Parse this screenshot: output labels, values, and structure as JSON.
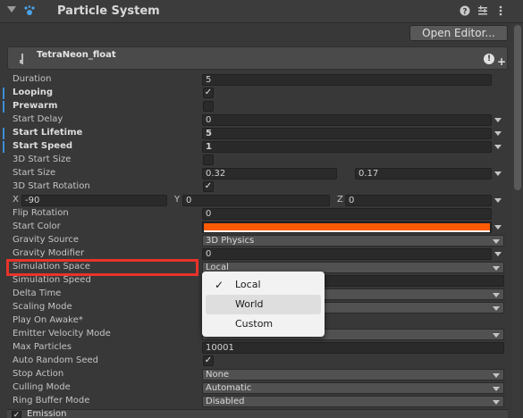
{
  "header": {
    "title": "Particle System",
    "icons": [
      "help-icon",
      "preset-icon",
      "more-icon"
    ]
  },
  "open_editor_label": "Open Editor...",
  "module": {
    "name": "TetraNeon_float",
    "plus": "+"
  },
  "rows": {
    "duration": {
      "label": "Duration",
      "value": "5"
    },
    "looping": {
      "label": "Looping",
      "checked": "✓"
    },
    "prewarm": {
      "label": "Prewarm",
      "checked": ""
    },
    "start_delay": {
      "label": "Start Delay",
      "value": "0"
    },
    "start_lifetime": {
      "label": "Start Lifetime",
      "value": "5"
    },
    "start_speed": {
      "label": "Start Speed",
      "value": "1"
    },
    "start_size_3d": {
      "label": "3D Start Size",
      "checked": ""
    },
    "start_size": {
      "label": "Start Size",
      "value_min": "0.32",
      "value_max": "0.17"
    },
    "start_rotation_3d": {
      "label": "3D Start Rotation",
      "checked": "✓"
    },
    "rotation_xyz": {
      "x_label": "X",
      "x": "-90",
      "y_label": "Y",
      "y": "0",
      "z_label": "Z",
      "z": "0"
    },
    "flip_rotation": {
      "label": "Flip Rotation",
      "value": "0"
    },
    "start_color": {
      "label": "Start Color",
      "color": "#fc5a03"
    },
    "gravity_source": {
      "label": "Gravity Source",
      "value": "3D Physics"
    },
    "gravity_modifier": {
      "label": "Gravity Modifier",
      "value": "0"
    },
    "simulation_space": {
      "label": "Simulation Space",
      "value": "Local"
    },
    "simulation_speed": {
      "label": "Simulation Speed"
    },
    "delta_time": {
      "label": "Delta Time"
    },
    "scaling_mode": {
      "label": "Scaling Mode"
    },
    "play_on_awake": {
      "label": "Play On Awake*"
    },
    "emitter_velocity_mode": {
      "label": "Emitter Velocity Mode"
    },
    "max_particles": {
      "label": "Max Particles",
      "value": "10001"
    },
    "auto_random_seed": {
      "label": "Auto Random Seed",
      "checked": "✓"
    },
    "stop_action": {
      "label": "Stop Action",
      "value": "None"
    },
    "culling_mode": {
      "label": "Culling Mode",
      "value": "Automatic"
    },
    "ring_buffer_mode": {
      "label": "Ring Buffer Mode",
      "value": "Disabled"
    }
  },
  "popup": {
    "options": [
      "Local",
      "World",
      "Custom"
    ],
    "selected": "Local",
    "highlighted": "World",
    "tick": "✓"
  },
  "emission": {
    "label": "Emission",
    "checked": "✓"
  },
  "colors": {
    "accent_bar": "#3d8fd6",
    "highlight_box": "#e8332b",
    "start_color": "#fc5a03"
  }
}
